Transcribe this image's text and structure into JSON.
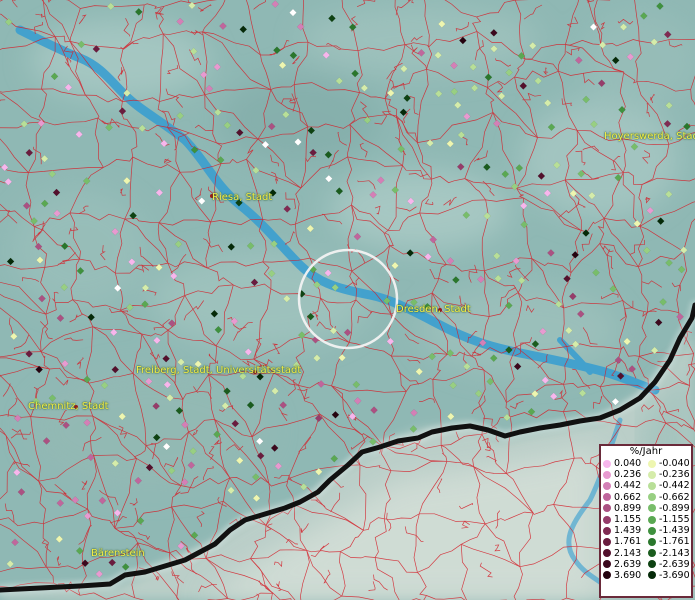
{
  "map": {
    "cities": {
      "riesa": "Riesa, Stadt",
      "dresden": "Dresden, Stadt",
      "hoyerswerda": "Hoyerswerda, Stadt",
      "freiberg": "Freiberg, Stadt, Universitätsstadt",
      "chemnitz": "Chemnitz, Stadt",
      "baerenstein": "Bärenstein"
    },
    "colors": {
      "terrain": "#8fb8b4",
      "river": "#3a9fd0",
      "border_lines": "#d4202a",
      "national_border": "#111111",
      "city_label": "#f3ee4a"
    }
  },
  "legend": {
    "title": "%/Jahr",
    "positive": [
      {
        "value": "0.040",
        "color": "#f7b6ec"
      },
      {
        "value": "0.236",
        "color": "#e89ad0"
      },
      {
        "value": "0.442",
        "color": "#d47fb6"
      },
      {
        "value": "0.662",
        "color": "#c0669c"
      },
      {
        "value": "0.899",
        "color": "#ab5182"
      },
      {
        "value": "1.155",
        "color": "#963c6a"
      },
      {
        "value": "1.439",
        "color": "#802a52"
      },
      {
        "value": "1.761",
        "color": "#6a1c3e"
      },
      {
        "value": "2.143",
        "color": "#53102c"
      },
      {
        "value": "2.639",
        "color": "#3c081d"
      },
      {
        "value": "3.690",
        "color": "#25030f"
      }
    ],
    "negative": [
      {
        "value": "-0.040",
        "color": "#eef6b0"
      },
      {
        "value": "-0.236",
        "color": "#d5ecaa"
      },
      {
        "value": "-0.442",
        "color": "#b8df98"
      },
      {
        "value": "-0.662",
        "color": "#98cf82"
      },
      {
        "value": "-0.899",
        "color": "#78bd6a"
      },
      {
        "value": "-1.155",
        "color": "#5aa852"
      },
      {
        "value": "-1.439",
        "color": "#3f913e"
      },
      {
        "value": "-1.761",
        "color": "#2a772c"
      },
      {
        "value": "-2.143",
        "color": "#1a5c1e"
      },
      {
        "value": "-2.639",
        "color": "#0e4212"
      },
      {
        "value": "-3.690",
        "color": "#052a08"
      }
    ]
  }
}
